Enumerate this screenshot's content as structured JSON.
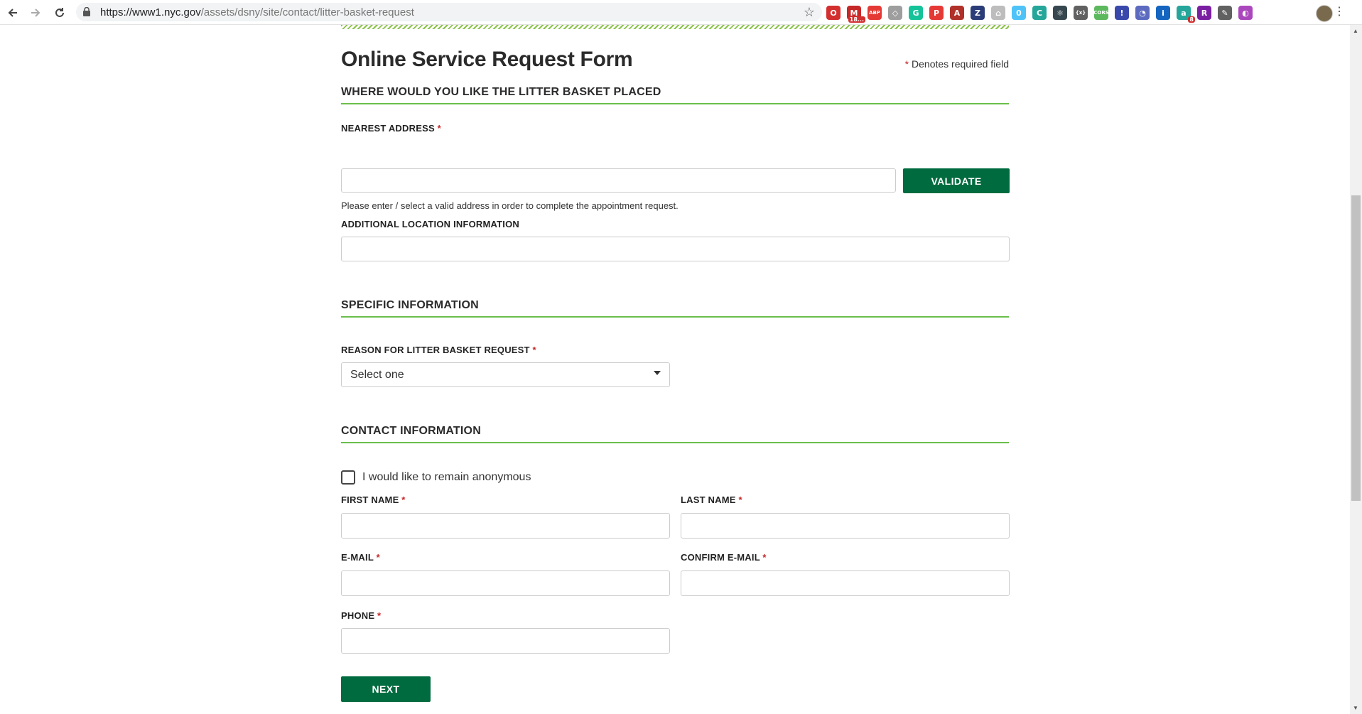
{
  "browser": {
    "url_host": "https://www1.nyc.gov",
    "url_path": "/assets/dsny/site/contact/litter-basket-request",
    "extensions": [
      {
        "name": "opera-icon",
        "color": "#d32f2f",
        "glyph": "O"
      },
      {
        "name": "gmail-icon",
        "color": "#c62828",
        "glyph": "M",
        "badge": "18..."
      },
      {
        "name": "adblock-icon",
        "color": "#e53935",
        "glyph": "ABP"
      },
      {
        "name": "shield-icon",
        "color": "#9e9e9e",
        "glyph": "◇"
      },
      {
        "name": "grammarly-icon",
        "color": "#15c39a",
        "glyph": "G"
      },
      {
        "name": "pocket-icon",
        "color": "#e53935",
        "glyph": "P"
      },
      {
        "name": "acrobat-icon",
        "color": "#b0302a",
        "glyph": "A"
      },
      {
        "name": "zotero-icon",
        "color": "#2a3d78",
        "glyph": "Z"
      },
      {
        "name": "tree-icon",
        "color": "#bdbdbd",
        "glyph": "⌂"
      },
      {
        "name": "counter-icon",
        "color": "#4fc3f7",
        "glyph": "0"
      },
      {
        "name": "copy-icon",
        "color": "#26a69a",
        "glyph": "C"
      },
      {
        "name": "react-icon",
        "color": "#37474f",
        "glyph": "⚛"
      },
      {
        "name": "json-icon",
        "color": "#616161",
        "glyph": "{x}"
      },
      {
        "name": "cors-icon",
        "color": "#5cb85c",
        "glyph": "CORS"
      },
      {
        "name": "tag-icon",
        "color": "#3949ab",
        "glyph": "!"
      },
      {
        "name": "compass-icon",
        "color": "#5c6bc0",
        "glyph": "◔"
      },
      {
        "name": "info-icon",
        "color": "#1565c0",
        "glyph": "i"
      },
      {
        "name": "a-icon",
        "color": "#26a69a",
        "glyph": "a",
        "badge": "8"
      },
      {
        "name": "r-icon",
        "color": "#7b1fa2",
        "glyph": "R"
      },
      {
        "name": "eyedropper-icon",
        "color": "#616161",
        "glyph": "✎"
      },
      {
        "name": "paint-icon",
        "color": "#ab47bc",
        "glyph": "◐"
      }
    ]
  },
  "form": {
    "title": "Online Service Request Form",
    "required_note": "Denotes required field",
    "required_mark": "*",
    "section_location": "WHERE WOULD YOU LIKE THE LITTER BASKET PLACED",
    "nearest_address_label": "NEAREST ADDRESS",
    "nearest_address_value": "",
    "validate_label": "VALIDATE",
    "address_hint": "Please enter / select a valid address in order to complete the appointment request.",
    "additional_location_label": "ADDITIONAL LOCATION INFORMATION",
    "additional_location_value": "",
    "section_specific": "SPECIFIC INFORMATION",
    "reason_label": "REASON FOR LITTER BASKET REQUEST",
    "reason_selected": "Select one",
    "section_contact": "CONTACT INFORMATION",
    "anonymous_label": "I would like to remain anonymous",
    "anonymous_checked": false,
    "first_name_label": "FIRST NAME",
    "last_name_label": "LAST NAME",
    "email_label": "E-MAIL",
    "confirm_email_label": "CONFIRM E-MAIL",
    "phone_label": "PHONE",
    "next_label": "NEXT"
  },
  "colors": {
    "accent_green": "#006b3f",
    "rule_green": "#6abf4b",
    "required_red": "#c62828"
  }
}
